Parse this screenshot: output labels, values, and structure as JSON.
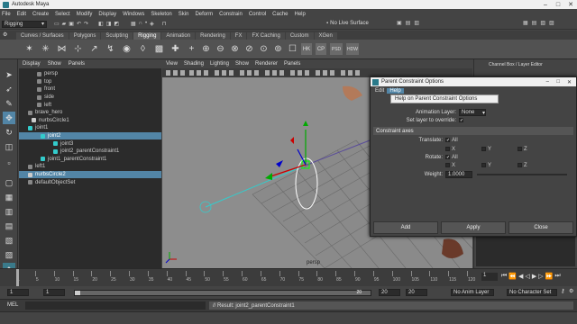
{
  "window": {
    "title": "Autodesk Maya"
  },
  "menubar": [
    "File",
    "Edit",
    "Create",
    "Select",
    "Modify",
    "Display",
    "Windows",
    "Skeleton",
    "Skin",
    "Deform",
    "Constrain",
    "Control",
    "Cache",
    "Help"
  ],
  "modebar": {
    "mode": "Rigging",
    "live_surface": "No Live Surface"
  },
  "shelf": {
    "tabs": [
      "Curves / Surfaces",
      "Polygons",
      "Sculpting",
      "Rigging",
      "Animation",
      "Rendering",
      "FX",
      "FX Caching",
      "Custom",
      "XGen"
    ],
    "active": "Rigging"
  },
  "outliner": {
    "menu": [
      "Display",
      "Show",
      "Panels"
    ],
    "rows": [
      {
        "label": "persp",
        "indent": 20,
        "sel": false
      },
      {
        "label": "top",
        "indent": 20,
        "sel": false
      },
      {
        "label": "front",
        "indent": 20,
        "sel": false
      },
      {
        "label": "side",
        "indent": 20,
        "sel": false
      },
      {
        "label": "left",
        "indent": 20,
        "sel": false
      },
      {
        "label": "brave_hero",
        "indent": 10,
        "sel": false
      },
      {
        "label": "nurbsCircle1",
        "indent": 14,
        "sel": false
      },
      {
        "label": "joint1",
        "indent": 10,
        "sel": false
      },
      {
        "label": "joint2",
        "indent": 24,
        "sel": true
      },
      {
        "label": "joint3",
        "indent": 38,
        "sel": false
      },
      {
        "label": "joint2_parentConstraint1",
        "indent": 38,
        "sel": false
      },
      {
        "label": "joint1_parentConstraint1",
        "indent": 24,
        "sel": false
      },
      {
        "label": "left1",
        "indent": 10,
        "sel": false
      },
      {
        "label": "nurbsCircle2",
        "indent": 10,
        "sel": true
      },
      {
        "label": "defaultObjectSet",
        "indent": 10,
        "sel": false
      }
    ]
  },
  "viewport": {
    "menu": [
      "View",
      "Shading",
      "Lighting",
      "Show",
      "Renderer",
      "Panels"
    ],
    "camera": "persp"
  },
  "rightpanel": {
    "tabs": [
      "Channel Box / Layer Editor"
    ]
  },
  "dialog": {
    "title": "Parent Constraint Options",
    "menu": [
      "Edit",
      "Help"
    ],
    "help_item": "Help on Parent Constraint Options",
    "animation_layer_label": "Animation Layer:",
    "animation_layer_value": "None",
    "set_layer_label": "Set layer to override:",
    "section": "Constraint axes",
    "translate_label": "Translate:",
    "rotate_label": "Rotate:",
    "weight_label": "Weight:",
    "weight_value": "1.0000",
    "all": "All",
    "axes": [
      "X",
      "Y",
      "Z"
    ],
    "buttons": {
      "add": "Add",
      "apply": "Apply",
      "close": "Close"
    }
  },
  "timeslider": {
    "ticks": [
      "1",
      "5",
      "10",
      "15",
      "20",
      "25",
      "30",
      "35",
      "40",
      "45",
      "50",
      "55",
      "60",
      "65",
      "70",
      "75",
      "80",
      "85",
      "90",
      "95",
      "100",
      "105",
      "110",
      "115",
      "120"
    ],
    "current": "1"
  },
  "range": {
    "start": "1",
    "inner_start": "1",
    "inner_end": "20",
    "end": "20",
    "anim_layer": "No Anim Layer",
    "char_set": "No Character Set"
  },
  "cmd": {
    "label": "MEL",
    "result": "// Result: joint2_parentConstraint1"
  }
}
